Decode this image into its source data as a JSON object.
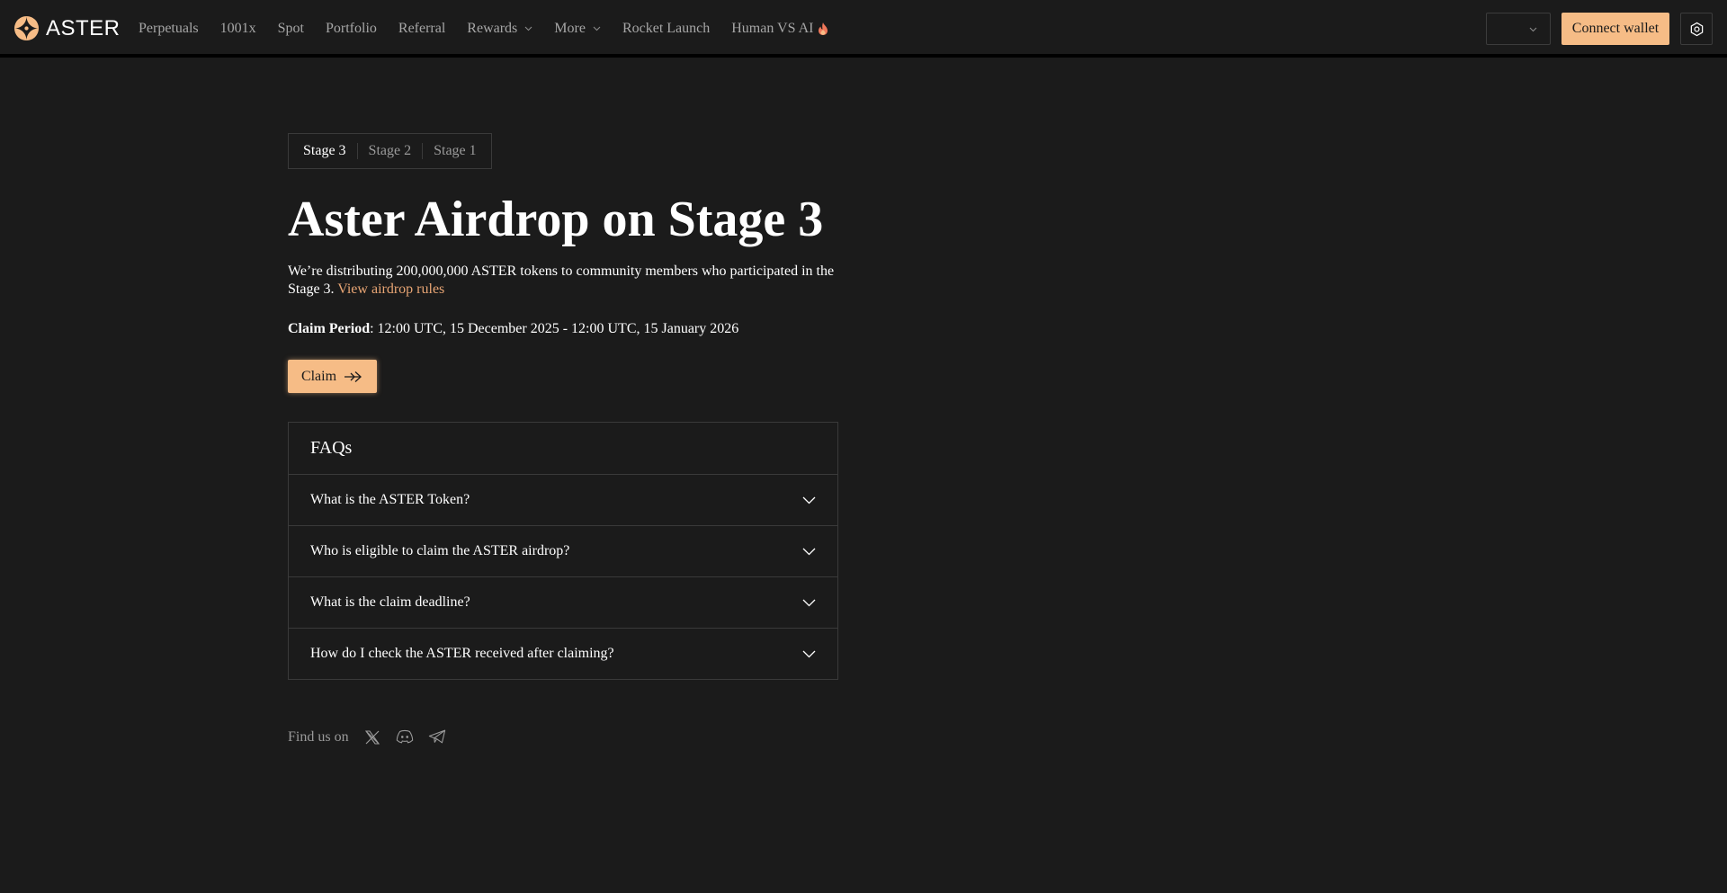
{
  "brand": {
    "name": "ASTER"
  },
  "nav": {
    "items": [
      {
        "label": "Perpetuals",
        "dropdown": false
      },
      {
        "label": "1001x",
        "dropdown": false
      },
      {
        "label": "Spot",
        "dropdown": false
      },
      {
        "label": "Portfolio",
        "dropdown": false
      },
      {
        "label": "Referral",
        "dropdown": false
      },
      {
        "label": "Rewards",
        "dropdown": true
      },
      {
        "label": "More",
        "dropdown": true
      },
      {
        "label": "Rocket Launch",
        "dropdown": false
      },
      {
        "label": "Human VS AI",
        "dropdown": false,
        "icon": "fire-icon"
      }
    ],
    "select_value": "",
    "connect_label": "Connect wallet",
    "settings_icon": "settings-icon"
  },
  "stages": {
    "tabs": [
      "Stage 3",
      "Stage 2",
      "Stage 1"
    ],
    "active": "Stage 3"
  },
  "hero": {
    "title": "Aster Airdrop on Stage 3",
    "description": "We’re distributing 200,000,000 ASTER tokens to community members who participated in the Stage 3.",
    "rules_link": "View airdrop rules",
    "claim_period_label": "Claim Period",
    "claim_period_value": ": 12:00 UTC, 15 December 2025 - 12:00 UTC, 15 January 2026",
    "claim_label": "Claim"
  },
  "faq": {
    "title": "FAQs",
    "items": [
      "What is the ASTER Token?",
      "Who is eligible to claim the ASTER airdrop?",
      "What is the claim deadline?",
      "How do I check the ASTER received after claiming?"
    ]
  },
  "footer": {
    "find_us": "Find us on",
    "socials": [
      "x-icon",
      "discord-icon",
      "telegram-icon"
    ]
  },
  "colors": {
    "background": "#1b1b1b",
    "accent": "#f6bc86",
    "link": "#e8a574",
    "muted_text": "#a6a6a6",
    "border": "#3a3a3a"
  }
}
